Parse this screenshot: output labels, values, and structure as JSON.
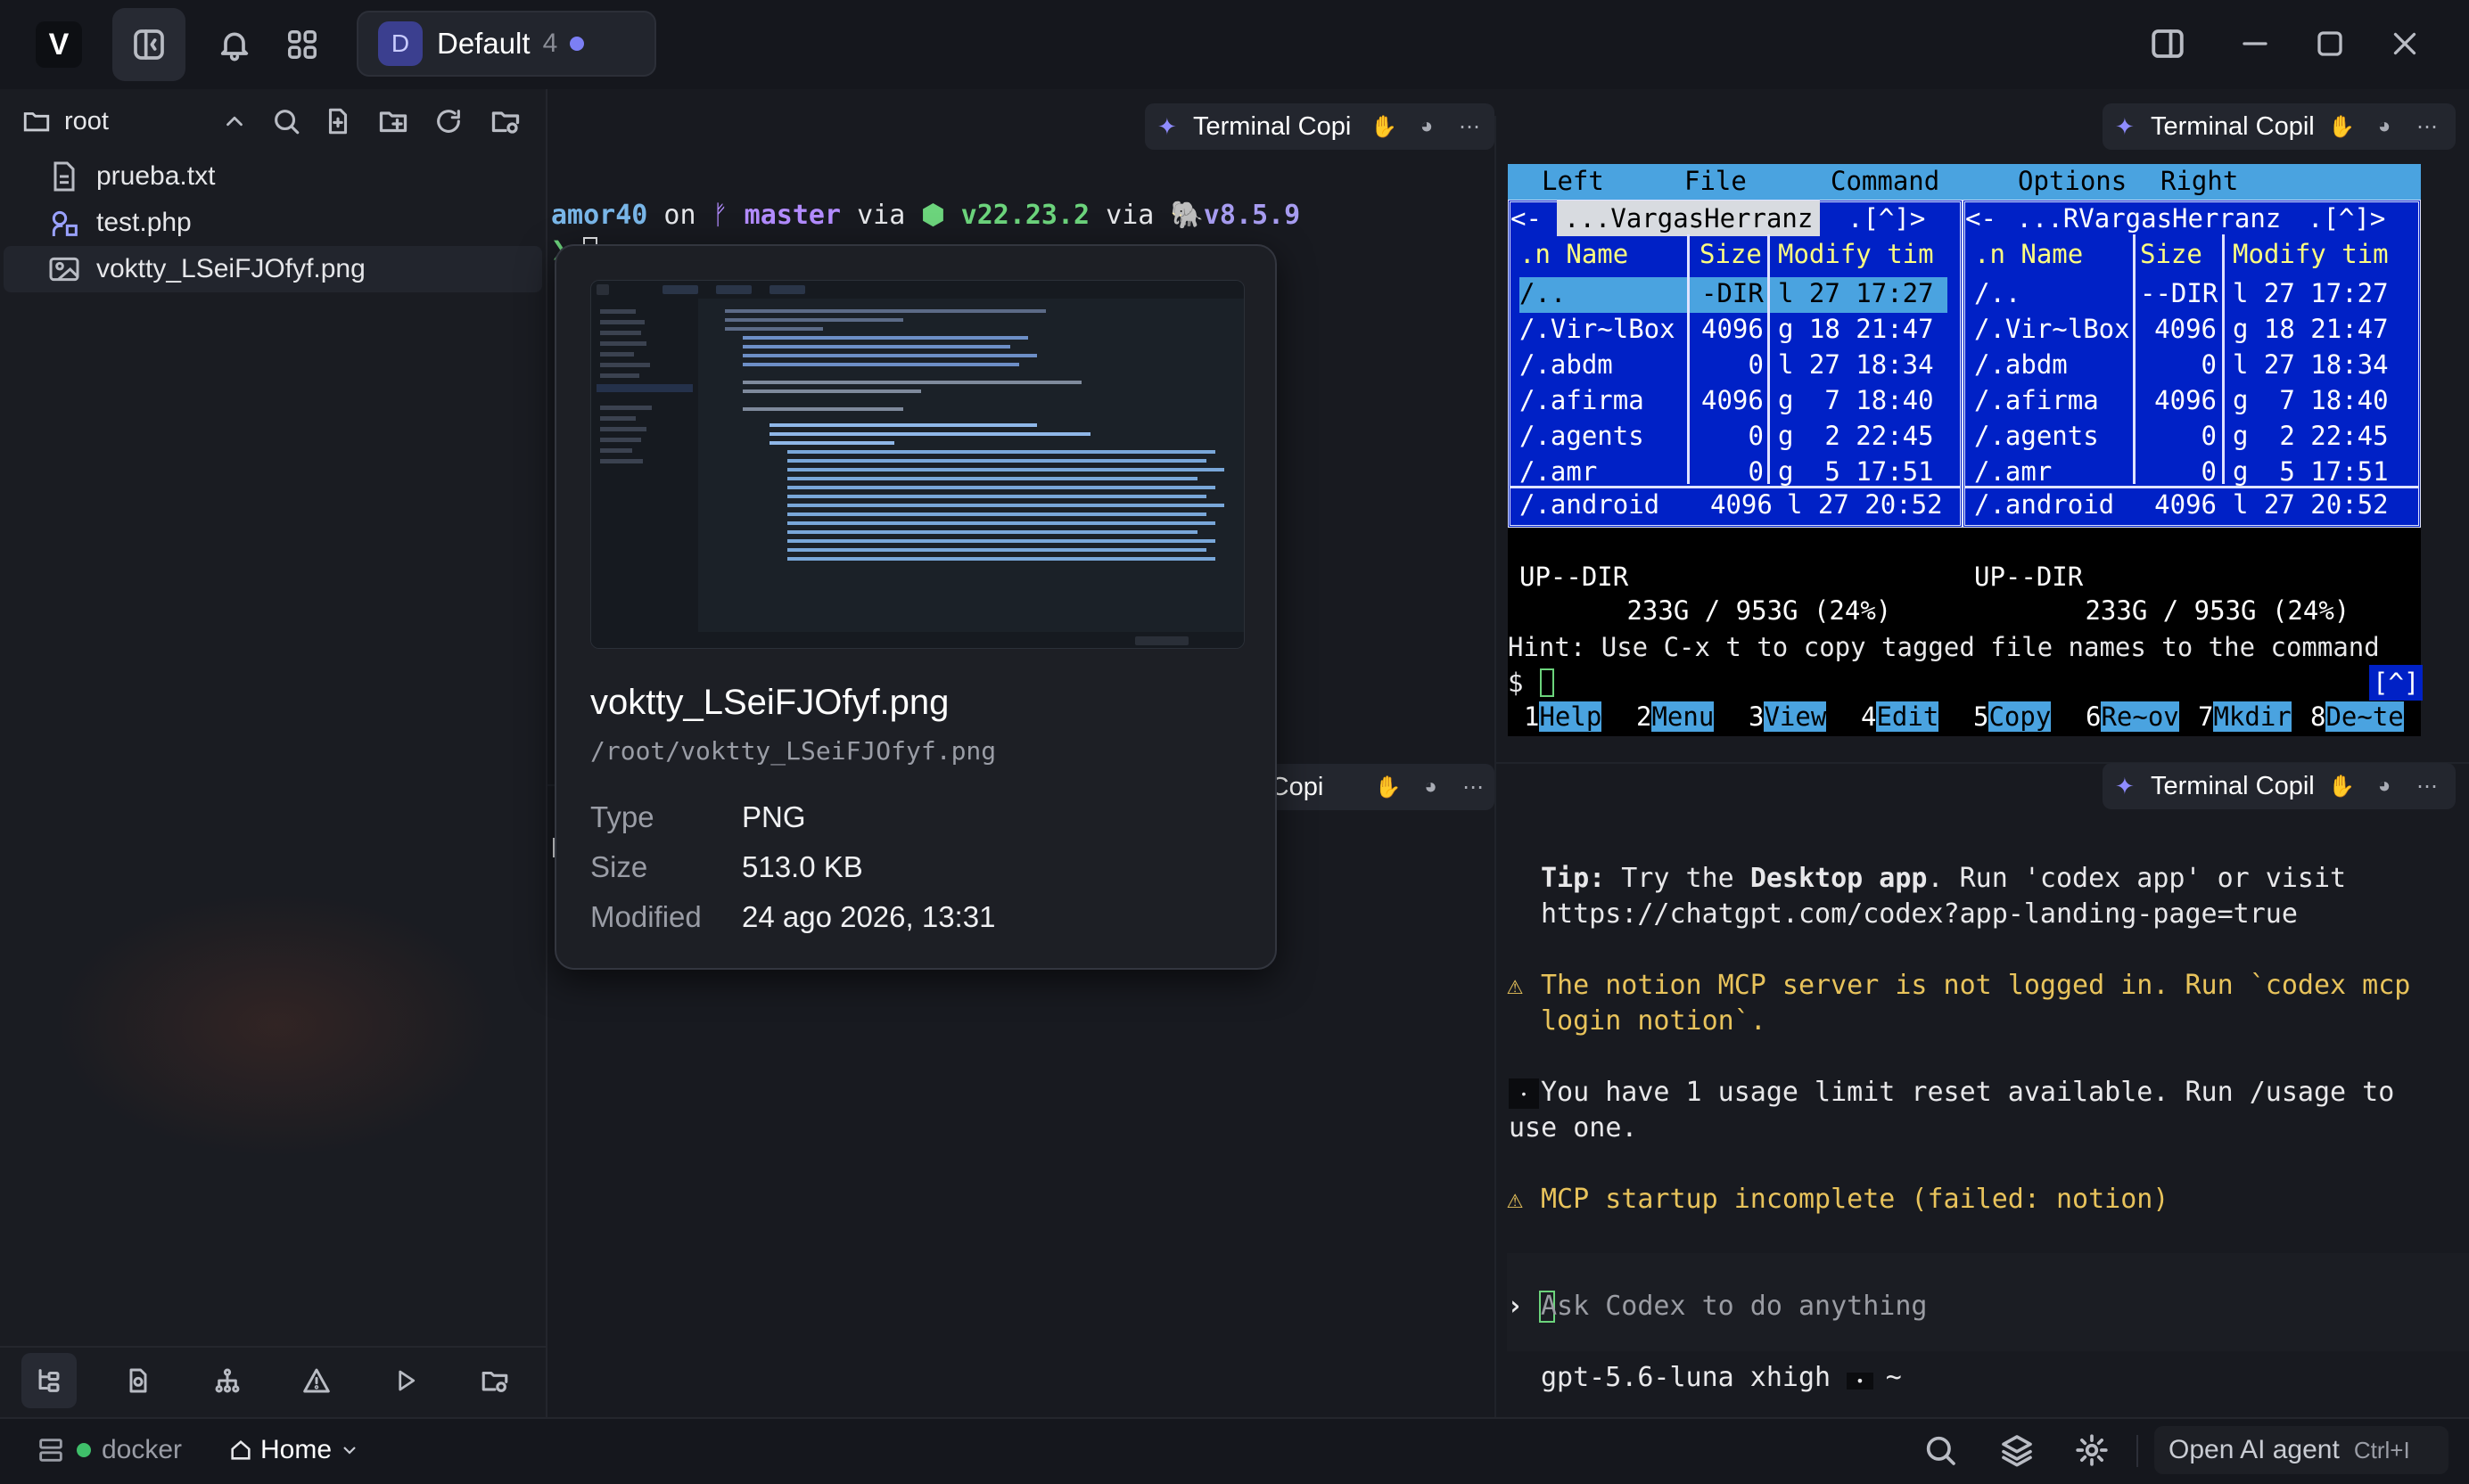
{
  "app": {
    "logo": "V",
    "accent": "#7c7ff5"
  },
  "topbar": {
    "workspace": {
      "avatar": "D",
      "name": "Default",
      "count": "4"
    },
    "icons": [
      "sidebar-toggle-icon",
      "bell-icon",
      "grid-icon",
      "split-view-icon",
      "minimize-icon",
      "maximize-icon",
      "close-icon"
    ]
  },
  "sidebar": {
    "root_label": "root",
    "files": [
      {
        "name": "prueba.txt",
        "icon": "text-file-icon"
      },
      {
        "name": "test.php",
        "icon": "php-file-icon"
      },
      {
        "name": "voktty_LSeiFJOfyf.png",
        "icon": "image-file-icon"
      }
    ]
  },
  "status": {
    "docker": "docker",
    "home": "Home",
    "agent": "Open AI agent",
    "shortcut": "Ctrl+I"
  },
  "tabs": {
    "tab1": "Terminal Copi",
    "tab2": "Terminal Copil",
    "tab3": "al Copi",
    "tab4": "Terminal Copil"
  },
  "terminal1": {
    "user": "amor40",
    "on": " on ",
    "branch_glyph": "ᚠ",
    "branch": " master",
    "via1": " via ",
    "node": "⬢ v22.23.2",
    "via2": " via ",
    "php": "🐘v8.5.9",
    "prompt": "❯"
  },
  "mc": {
    "menu": [
      "Left",
      "File",
      "Command",
      "Options",
      "Right"
    ],
    "left_title": "...VargasHerranz",
    "right_title": " ...RVargasHerranz ",
    "corner": ".[^]>",
    "headers": {
      "name": ".n Name",
      "size": "Size",
      "mod": "Modify tim"
    },
    "rows": [
      {
        "name": "/..",
        "size": "-DIR",
        "size_r": "--DIR",
        "mod": "l 27 17:27"
      },
      {
        "name": "/.Vir~lBox",
        "size": "4096",
        "size_r": "4096",
        "mod": "g 18 21:47"
      },
      {
        "name": "/.abdm",
        "size": "0",
        "size_r": "0",
        "mod": "l 27 18:34"
      },
      {
        "name": "/.afirma",
        "size": "4096",
        "size_r": "4096",
        "mod": "g  7 18:40"
      },
      {
        "name": "/.agents",
        "size": "0",
        "size_r": "0",
        "mod": "g  2 22:45"
      },
      {
        "name": "/.amr",
        "size": "0",
        "size_r": "0",
        "mod": "g  5 17:51"
      },
      {
        "name": "/.android",
        "size": "4096",
        "size_r": "4096",
        "mod": "l 27 20:52"
      }
    ],
    "status_left": "UP--DIR",
    "status_right": "UP--DIR",
    "disk": " 233G / 953G (24%) ",
    "hint": "Hint: Use C-x t to copy tagged file names to the command",
    "prompt": "$ ",
    "bracket": "[^]",
    "fkeys": [
      {
        "n": "1",
        "label": "Help"
      },
      {
        "n": "2",
        "label": "Menu"
      },
      {
        "n": "3",
        "label": "View"
      },
      {
        "n": "4",
        "label": "Edit"
      },
      {
        "n": "5",
        "label": "Copy"
      },
      {
        "n": "6",
        "label": "Re~ov"
      },
      {
        "n": "7",
        "label": "Mkdir"
      },
      {
        "n": "8",
        "label": "De~te"
      }
    ]
  },
  "codex": {
    "tip_label": "Tip:",
    "tip_1": " Try the ",
    "tip_bold": "Desktop app",
    "tip_2": ". Run 'codex app' or visit",
    "tip_3": "https://chatgpt.com/codex?app-landing-page=true",
    "warn1_a": "The notion MCP server is not logged in. Run `codex mcp",
    "warn1_b": "login notion`.",
    "usage_a": "You have 1 usage limit reset available. Run /usage to",
    "usage_b": "use one.",
    "warn2": "MCP startup incomplete (failed: notion)",
    "input_placeholder": "Ask Codex to do anything",
    "model": "gpt-5.6-luna xhigh",
    "cwd": "~"
  },
  "popup": {
    "filename": "voktty_LSeiFJOfyf.png",
    "path": "/root/voktty_LSeiFJOfyf.png",
    "type_label": "Type",
    "type_value": "PNG",
    "size_label": "Size",
    "size_value": "513.0 KB",
    "modified_label": "Modified",
    "modified_value": "24 ago 2026, 13:31"
  }
}
